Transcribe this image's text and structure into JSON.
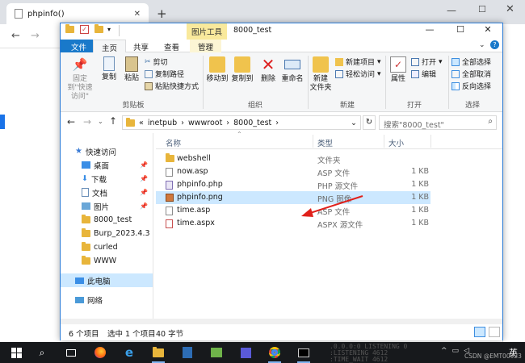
{
  "browser": {
    "tab_title": "phpinfo()",
    "new_tab_glyph": "+",
    "controls": {
      "minimize": "—",
      "maximize": "☐",
      "close": "✕"
    },
    "nav": {
      "back": "←",
      "forward": "→"
    }
  },
  "explorer": {
    "context_tab": "图片工具",
    "title": "8000_test",
    "ribbon_tabs": [
      "文件",
      "主页",
      "共享",
      "查看",
      "管理"
    ],
    "ribbon": {
      "clipboard": {
        "pin": "固定到\"快速访问\"",
        "copy": "复制",
        "paste": "粘贴",
        "cut": "剪切",
        "copy_path": "复制路径",
        "paste_shortcut": "粘贴快捷方式",
        "group": "剪贴板"
      },
      "organize": {
        "move_to": "移动到",
        "copy_to": "复制到",
        "delete": "删除",
        "rename": "重命名",
        "group": "组织"
      },
      "new": {
        "new_folder": "新建\n文件夹",
        "new_item": "新建项目",
        "easy_access": "轻松访问",
        "group": "新建"
      },
      "open": {
        "properties": "属性",
        "open": "打开",
        "edit": "编辑",
        "group": "打开"
      },
      "select": {
        "select_all": "全部选择",
        "select_none": "全部取消",
        "invert": "反向选择",
        "group": "选择"
      }
    },
    "address": {
      "breadcrumb": [
        "«",
        "inetpub",
        "wwwroot",
        "8000_test"
      ],
      "search_placeholder": "搜索\"8000_test\""
    },
    "nav_pane": {
      "quick_access": "快速访问",
      "items": [
        {
          "label": "桌面",
          "pinned": true
        },
        {
          "label": "下载",
          "pinned": true
        },
        {
          "label": "文档",
          "pinned": true
        },
        {
          "label": "图片",
          "pinned": true
        },
        {
          "label": "8000_test",
          "pinned": false
        },
        {
          "label": "Burp_2023.4.3",
          "pinned": false
        },
        {
          "label": "curled",
          "pinned": false
        },
        {
          "label": "WWW",
          "pinned": false
        }
      ],
      "this_pc": "此电脑",
      "network": "网络"
    },
    "columns": {
      "name": "名称",
      "type": "类型",
      "size": "大小"
    },
    "files": [
      {
        "name": "webshell",
        "type": "文件夹",
        "size": "",
        "icon": "folder-icon"
      },
      {
        "name": "now.asp",
        "type": "ASP 文件",
        "size": "1 KB",
        "icon": "asp-file-icon"
      },
      {
        "name": "phpinfo.php",
        "type": "PHP 源文件",
        "size": "1 KB",
        "icon": "php-file-icon"
      },
      {
        "name": "phpinfo.png",
        "type": "PNG 图像",
        "size": "1 KB",
        "icon": "png-image-icon",
        "selected": true
      },
      {
        "name": "time.asp",
        "type": "ASP 文件",
        "size": "1 KB",
        "icon": "asp-file-icon"
      },
      {
        "name": "time.aspx",
        "type": "ASPX 源文件",
        "size": "1 KB",
        "icon": "aspx-file-icon"
      }
    ],
    "status": {
      "count": "6 个项目",
      "selected": "选中 1 个项目",
      "size": "40 字节"
    }
  },
  "taskbar": {
    "terminal_lines": [
      ".0.0.0:0        LISTENING        0",
      ":LISTENING       4612",
      ":TIME_WAIT       4612"
    ],
    "tray_time": "^",
    "lang": "英",
    "watermark": "CSDN @EMT00923"
  },
  "colors": {
    "accent": "#1979ca",
    "selection": "#cce8ff",
    "taskbar": "#17191c",
    "context_tab": "#f9e99c"
  }
}
